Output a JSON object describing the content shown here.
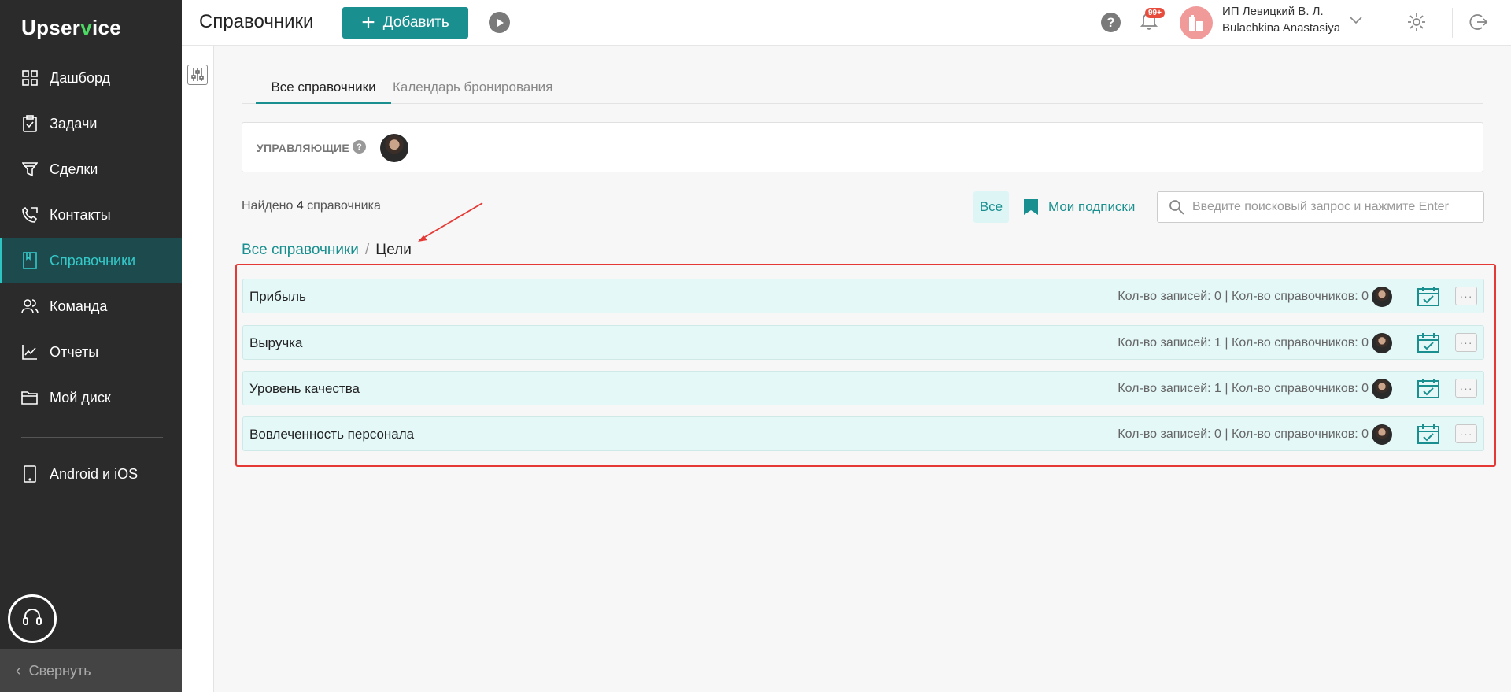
{
  "sidebar": {
    "logo_pre": "Upser",
    "logo_v": "v",
    "logo_post": "ice",
    "items": [
      {
        "label": "Дашборд",
        "icon": "dashboard-icon"
      },
      {
        "label": "Задачи",
        "icon": "tasks-icon"
      },
      {
        "label": "Сделки",
        "icon": "funnel-icon"
      },
      {
        "label": "Контакты",
        "icon": "phone-icon"
      },
      {
        "label": "Справочники",
        "icon": "book-icon",
        "active": true
      },
      {
        "label": "Команда",
        "icon": "team-icon"
      },
      {
        "label": "Отчеты",
        "icon": "chart-icon"
      },
      {
        "label": "Мой диск",
        "icon": "folder-icon"
      }
    ],
    "mobile_label": "Android и iOS",
    "collapse_label": "Свернуть"
  },
  "header": {
    "title": "Справочники",
    "add_label": "Добавить",
    "notifications_badge": "99+",
    "company": "ИП Левицкий В. Л.",
    "user": "Bulachkina Anastasiya"
  },
  "tabs": [
    {
      "label": "Все справочники",
      "active": true
    },
    {
      "label": "Календарь бронирования",
      "active": false
    }
  ],
  "managers": {
    "label": "УПРАВЛЯЮЩИЕ",
    "help": "?"
  },
  "found": {
    "prefix": "Найдено",
    "count": "4",
    "suffix": "справочника"
  },
  "filters": {
    "all_label": "Все",
    "subscriptions_label": "Мои подписки"
  },
  "search": {
    "placeholder": "Введите поисковый запрос и нажмите Enter"
  },
  "breadcrumb": {
    "root": "Все справочники",
    "separator": "/",
    "current": "Цели"
  },
  "rows": [
    {
      "title": "Прибыль",
      "stats": "Кол-во записей: 0 | Кол-во справочников: 0"
    },
    {
      "title": "Выручка",
      "stats": "Кол-во записей: 1 | Кол-во справочников: 0"
    },
    {
      "title": "Уровень качества",
      "stats": "Кол-во записей: 1 | Кол-во справочников: 0"
    },
    {
      "title": "Вовлеченность персонала",
      "stats": "Кол-во записей: 0 | Кол-во справочников: 0"
    }
  ],
  "colors": {
    "accent": "#1a8f8f",
    "sidebar_bg": "#2b2b2b",
    "highlight": "#e53935"
  }
}
